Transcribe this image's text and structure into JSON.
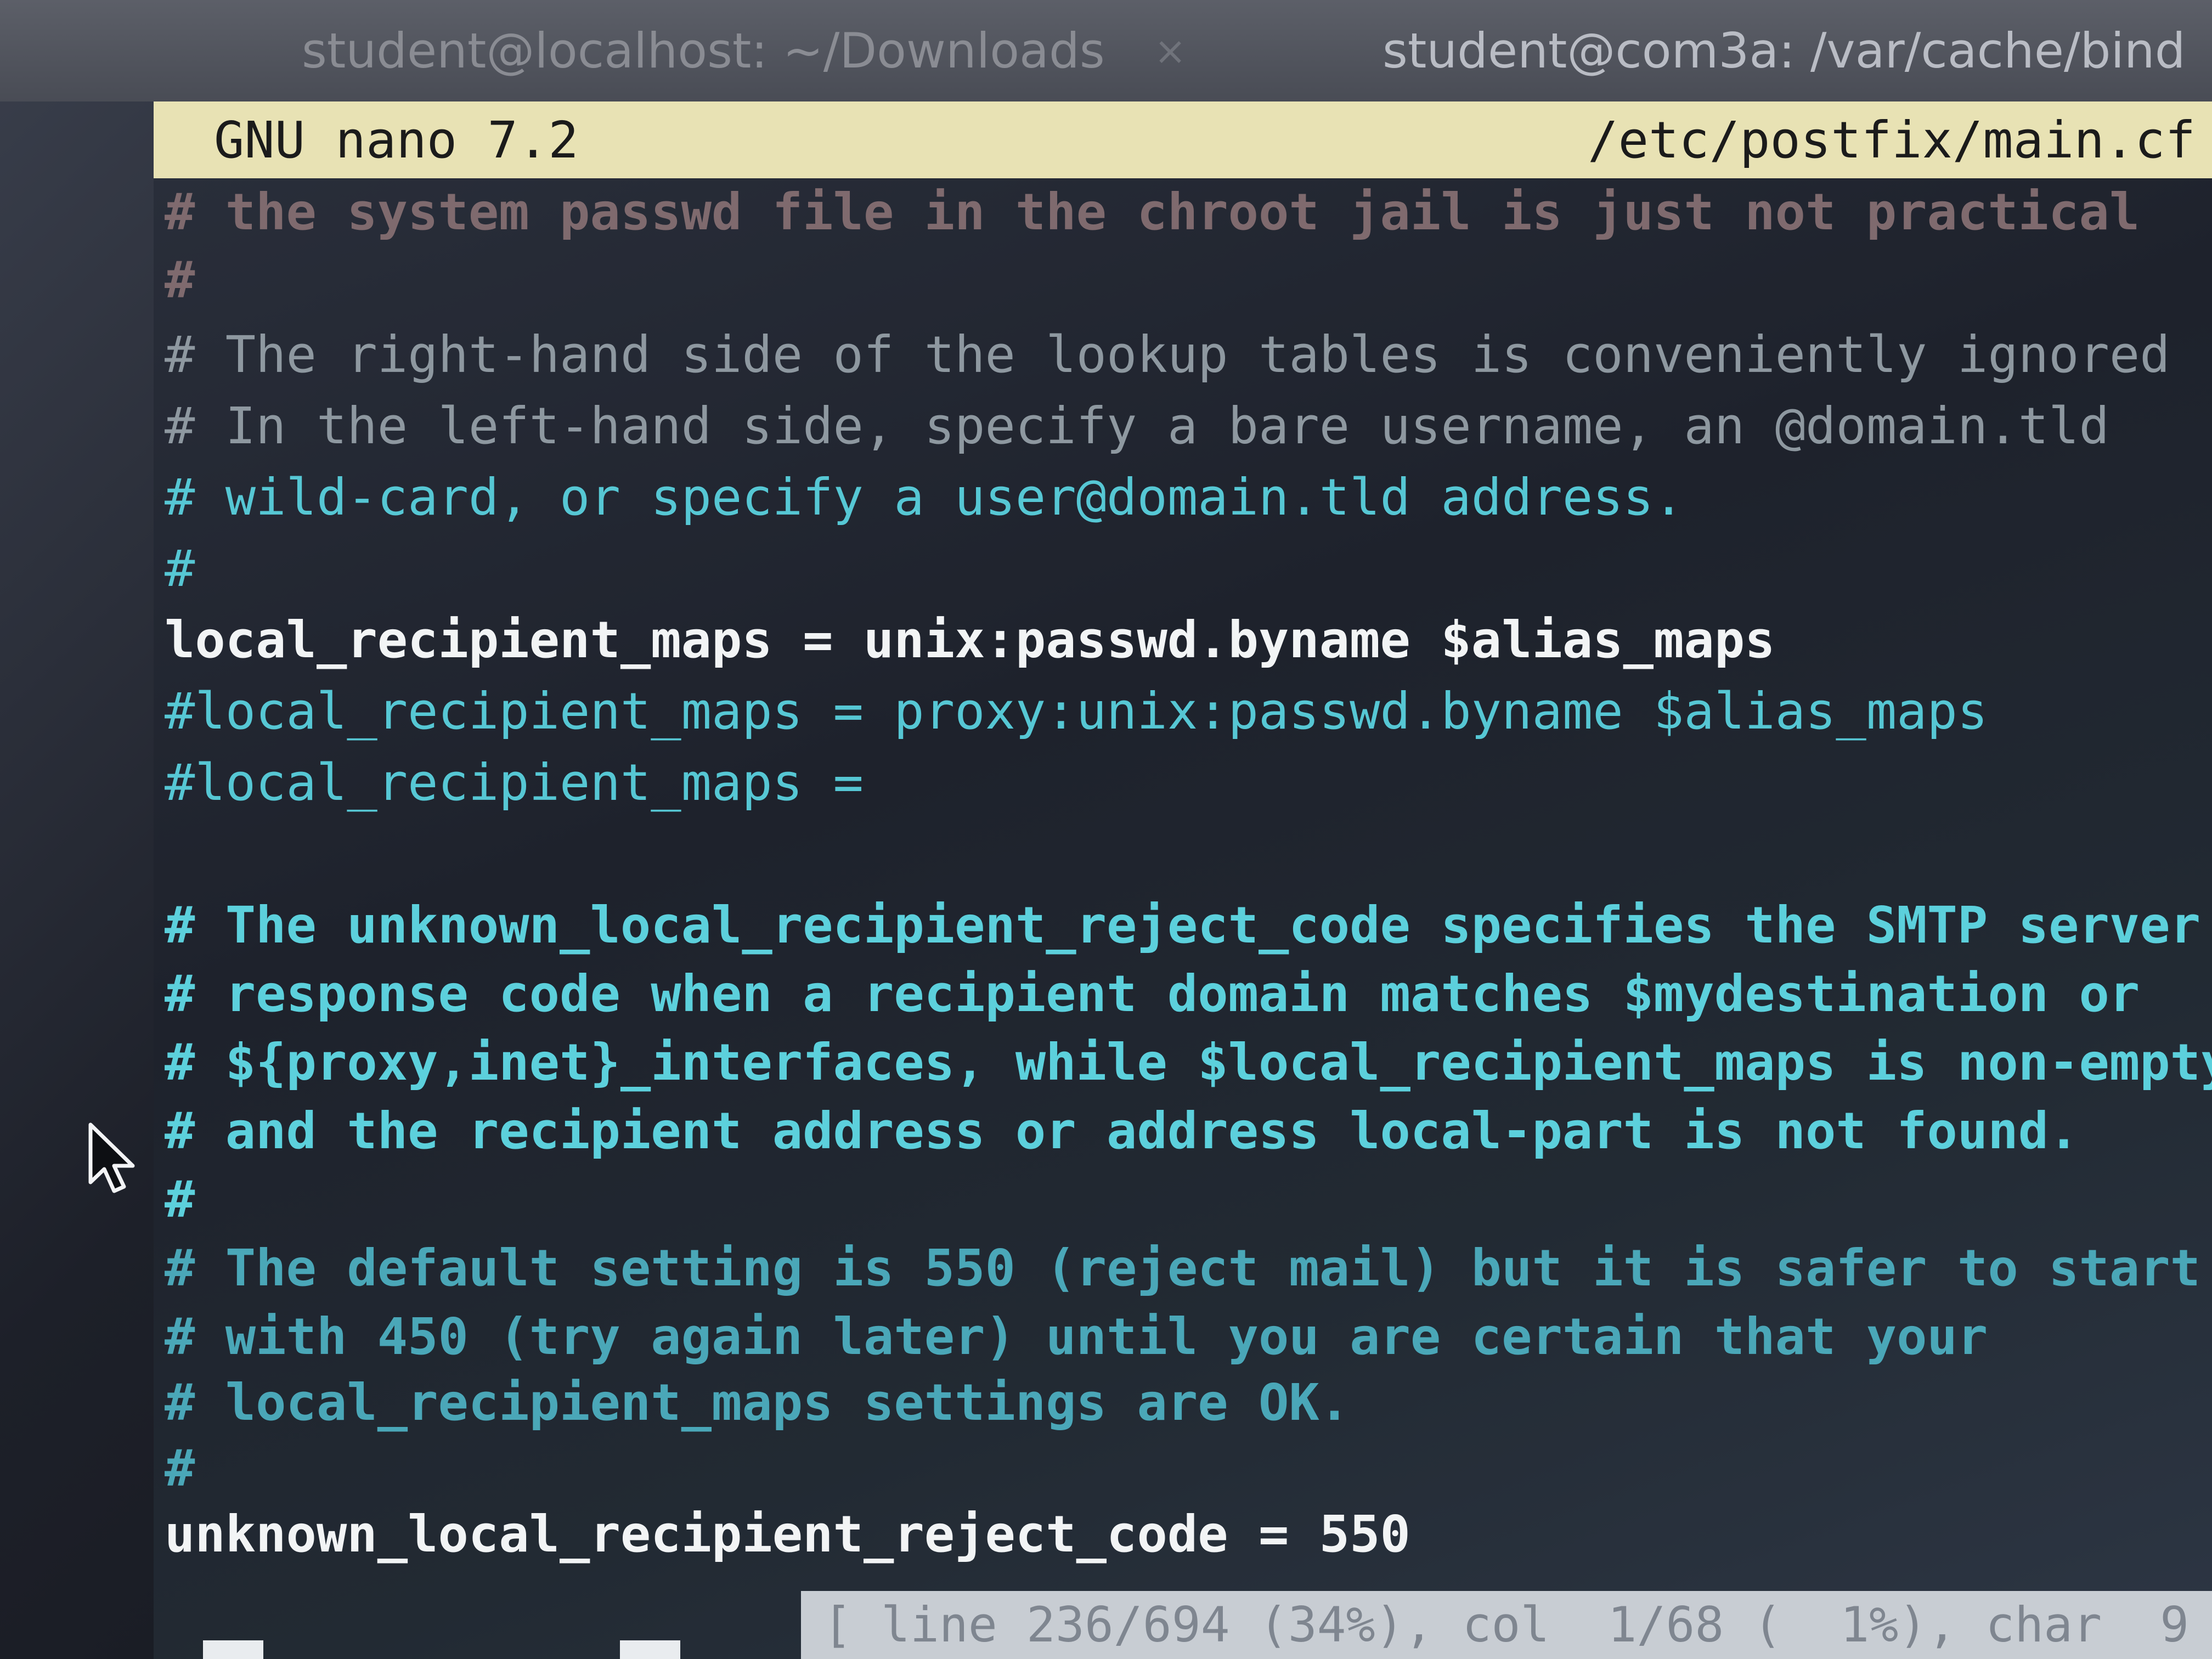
{
  "tabs": [
    {
      "title": "student@localhost: ~/Downloads",
      "close": "×"
    },
    {
      "title": "student@com3a: /var/cache/bind",
      "close": "×"
    }
  ],
  "nano": {
    "version": "GNU nano 7.2",
    "filename": "/etc/postfix/main.cf"
  },
  "lines": [
    {
      "text": "# the system passwd file in the chroot jail is just not practical",
      "style": "dim"
    },
    {
      "text": "#",
      "style": "dim"
    },
    {
      "text": "# The right-hand side of the lookup tables is conveniently ignored",
      "style": "gray"
    },
    {
      "text": "# In the left-hand side, specify a bare username, an @domain.tld",
      "style": "gray"
    },
    {
      "text": "# wild-card, or specify a user@domain.tld address.",
      "style": "cyan"
    },
    {
      "text": "#",
      "style": "cyan"
    },
    {
      "text": "local_recipient_maps = unix:passwd.byname $alias_maps",
      "style": "white"
    },
    {
      "text": "#local_recipient_maps = proxy:unix:passwd.byname $alias_maps",
      "style": "cyan"
    },
    {
      "text": "#local_recipient_maps =",
      "style": "cyan"
    },
    {
      "text": "",
      "style": "cyan"
    },
    {
      "text": "# The unknown_local_recipient_reject_code specifies the SMTP server",
      "style": "cyanb"
    },
    {
      "text": "# response code when a recipient domain matches $mydestination or",
      "style": "cyanb"
    },
    {
      "text": "# ${proxy,inet}_interfaces, while $local_recipient_maps is non-empty",
      "style": "cyanb"
    },
    {
      "text": "# and the recipient address or address local-part is not found.",
      "style": "cyanb"
    },
    {
      "text": "#",
      "style": "cyanb"
    },
    {
      "text": "# The default setting is 550 (reject mail) but it is safer to start",
      "style": "teal"
    },
    {
      "text": "# with 450 (try again later) until you are certain that your",
      "style": "teal"
    },
    {
      "text": "# local_recipient_maps settings are OK.",
      "style": "teal"
    },
    {
      "text": "#",
      "style": "teal"
    },
    {
      "text": "unknown_local_recipient_reject_code = 550",
      "style": "white"
    }
  ],
  "status": {
    "text": "[ line 236/694 (34%), col  1/68 (  1%), char  9"
  }
}
